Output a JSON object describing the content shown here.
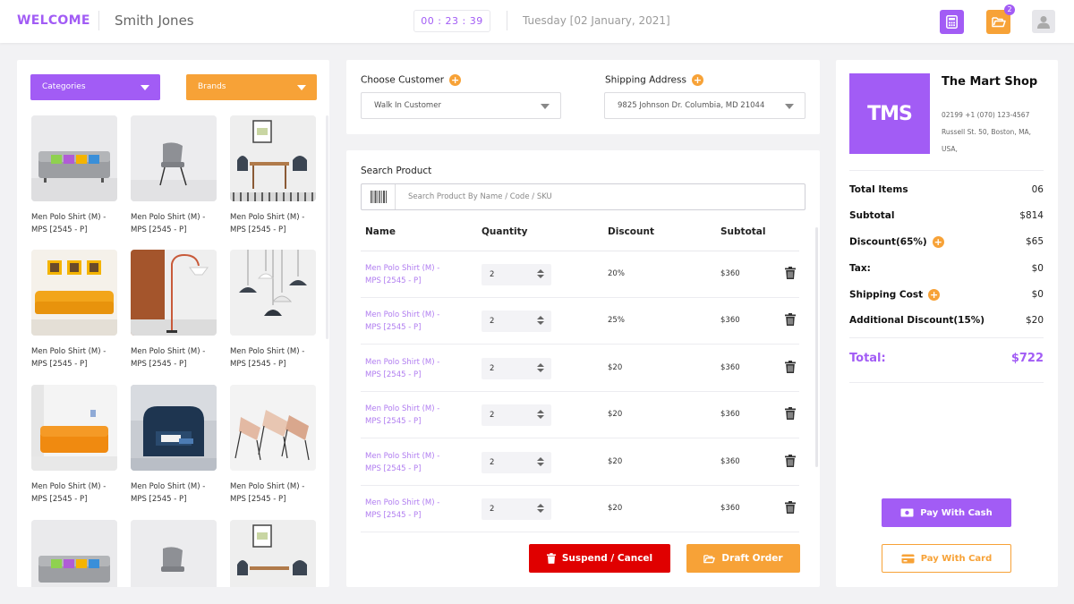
{
  "header": {
    "welcome": "WELCOME",
    "user_name": "Smith Jones",
    "timer": "00 : 23 : 39",
    "date": "Tuesday [02 January, 2021]",
    "folder_badge": "2"
  },
  "filters": {
    "categories_label": "Categories",
    "brands_label": "Brands"
  },
  "products": [
    {
      "line1": "Men Polo Shirt (M) -",
      "line2": "MPS [2545 - P]",
      "image": "sofa-gray"
    },
    {
      "line1": "Men Polo Shirt (M) -",
      "line2": "MPS [2545 - P]",
      "image": "chair-gray"
    },
    {
      "line1": "Men Polo Shirt (M) -",
      "line2": "MPS [2545 - P]",
      "image": "dining-set"
    },
    {
      "line1": "Men Polo Shirt (M) -",
      "line2": "MPS [2545 - P]",
      "image": "sofa-yellow"
    },
    {
      "line1": "Men Polo Shirt (M) -",
      "line2": "MPS [2545 - P]",
      "image": "floor-lamp"
    },
    {
      "line1": "Men Polo Shirt (M) -",
      "line2": "MPS [2545 - P]",
      "image": "pendant-lamps"
    },
    {
      "line1": "Men Polo Shirt (M) -",
      "line2": "MPS [2545 - P]",
      "image": "sofa-orange"
    },
    {
      "line1": "Men Polo Shirt (M) -",
      "line2": "MPS [2545 - P]",
      "image": "armchair-blue"
    },
    {
      "line1": "Men Polo Shirt (M) -",
      "line2": "MPS [2545 - P]",
      "image": "chairs-wood"
    },
    {
      "line1": "",
      "line2": "",
      "image": "sofa-gray"
    },
    {
      "line1": "",
      "line2": "",
      "image": "chair-gray"
    },
    {
      "line1": "",
      "line2": "",
      "image": "dining-set"
    }
  ],
  "customer": {
    "label": "Choose Customer",
    "value": "Walk In Customer",
    "shipping_label": "Shipping Address",
    "shipping_value": "9825 Johnson Dr. Columbia, MD 21044"
  },
  "search": {
    "label": "Search Product",
    "placeholder": "Search Product By Name / Code / SKU"
  },
  "table": {
    "headers": {
      "name": "Name",
      "quantity": "Quantity",
      "discount": "Discount",
      "subtotal": "Subtotal"
    },
    "rows": [
      {
        "name1": "Men Polo Shirt (M) -",
        "name2": "MPS [2545 - P]",
        "qty": "2",
        "discount": "20%",
        "subtotal": "$360"
      },
      {
        "name1": "Men Polo Shirt (M) -",
        "name2": "MPS [2545 - P]",
        "qty": "2",
        "discount": "25%",
        "subtotal": "$360"
      },
      {
        "name1": "Men Polo Shirt (M) -",
        "name2": "MPS [2545 - P]",
        "qty": "2",
        "discount": "$20",
        "subtotal": "$360"
      },
      {
        "name1": "Men Polo Shirt (M) -",
        "name2": "MPS [2545 - P]",
        "qty": "2",
        "discount": "$20",
        "subtotal": "$360"
      },
      {
        "name1": "Men Polo Shirt (M) -",
        "name2": "MPS [2545 - P]",
        "qty": "2",
        "discount": "$20",
        "subtotal": "$360"
      },
      {
        "name1": "Men Polo Shirt (M) -",
        "name2": "MPS [2545 - P]",
        "qty": "2",
        "discount": "$20",
        "subtotal": "$360"
      }
    ]
  },
  "actions": {
    "suspend_label": "Suspend / Cancel",
    "draft_label": "Draft Order"
  },
  "shop": {
    "logo": "TMS",
    "name": "The Mart Shop",
    "phone": "02199 +1 (070) 123-4567",
    "address1": "Russell St. 50, Boston, MA,",
    "address2": "USA,"
  },
  "summary": {
    "total_items_label": "Total Items",
    "total_items": "06",
    "subtotal_label": "Subtotal",
    "subtotal": "$814",
    "discount_label": "Discount(65%)",
    "discount": "$65",
    "tax_label": "Tax:",
    "tax": "$0",
    "shipping_label": "Shipping Cost",
    "shipping": "$0",
    "additional_label": "Additional Discount(15%)",
    "additional": "$20",
    "total_label": "Total:",
    "total": "$722"
  },
  "payment": {
    "cash_label": "Pay With Cash",
    "card_label": "Pay With Card"
  },
  "colors": {
    "primary": "#a25cf5",
    "accent": "#f7a237",
    "danger": "#e00000"
  }
}
